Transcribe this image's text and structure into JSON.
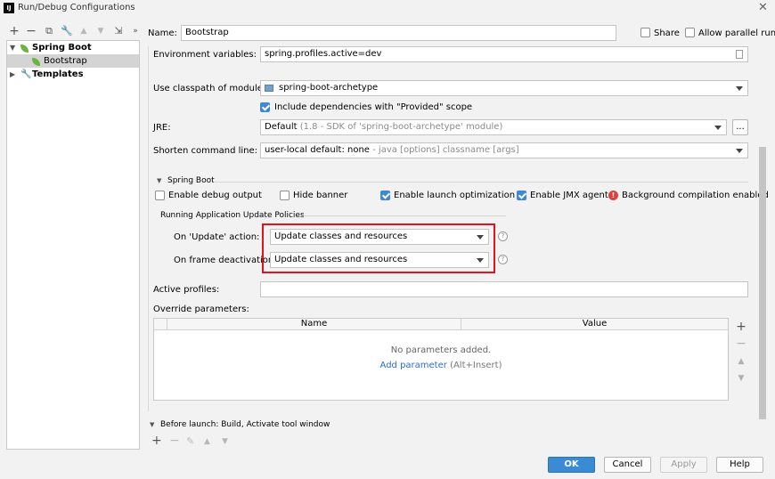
{
  "window": {
    "title": "Run/Debug Configurations",
    "app_icon_text": "IJ"
  },
  "toolbar": {
    "icons": [
      "plus-icon",
      "minus-icon",
      "copy-icon",
      "wrench-icon",
      "arrow-up-icon",
      "arrow-down-icon",
      "move-to-folder-icon",
      "expand-more-icon"
    ]
  },
  "tree": {
    "items": [
      {
        "label": "Spring Boot"
      },
      {
        "label": "Bootstrap"
      },
      {
        "label": "Templates"
      }
    ]
  },
  "header": {
    "name_label": "Name:",
    "name_value": "Bootstrap",
    "share_label": "Share",
    "allow_parallel_label": "Allow parallel run"
  },
  "form": {
    "env_label": "Environment variables:",
    "env_value": "spring.profiles.active=dev",
    "classpath_label": "Use classpath of module:",
    "classpath_value": "spring-boot-archetype",
    "include_deps_label": "Include dependencies with \"Provided\" scope",
    "jre_label": "JRE:",
    "jre_value": "Default",
    "jre_hint": "(1.8 - SDK of 'spring-boot-archetype' module)",
    "jre_more": "...",
    "shorten_label": "Shorten command line:",
    "shorten_value": "user-local default: none",
    "shorten_hint": "- java [options] classname [args]"
  },
  "spring_boot": {
    "section_label": "Spring Boot",
    "debug_output_label": "Enable debug output",
    "hide_banner_label": "Hide banner",
    "launch_opt_label": "Enable launch optimization",
    "jmx_label": "Enable JMX agent",
    "bg_compile_label": "Background compilation enabled",
    "update_policies_label": "Running Application Update Policies",
    "on_update_label": "On 'Update' action:",
    "on_update_value": "Update classes and resources",
    "on_frame_label": "On frame deactivation:",
    "on_frame_value": "Update classes and resources",
    "help_glyph": "?"
  },
  "profiles": {
    "label": "Active profiles:",
    "value": ""
  },
  "override": {
    "label": "Override parameters:",
    "col_name": "Name",
    "col_value": "Value",
    "empty_text": "No parameters added.",
    "add_link": "Add parameter",
    "add_shortcut": "(Alt+Insert)"
  },
  "before_launch": {
    "label": "Before launch: Build, Activate tool window"
  },
  "buttons": {
    "ok": "OK",
    "cancel": "Cancel",
    "apply": "Apply",
    "help": "Help"
  },
  "colors": {
    "accent": "#3a8ad4",
    "highlight_box": "#e0131f",
    "spring_green": "#6db33f",
    "error_red": "#e0403c"
  }
}
